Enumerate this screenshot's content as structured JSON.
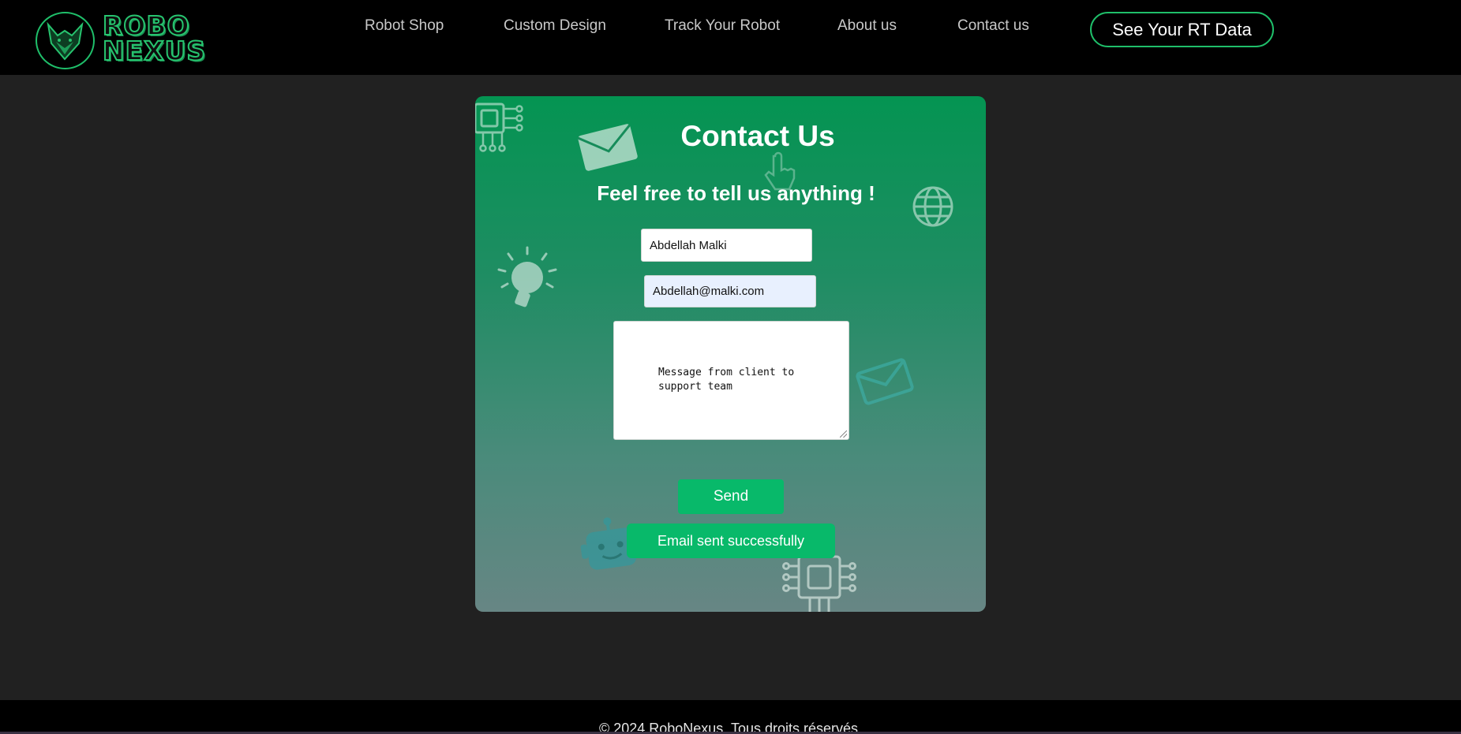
{
  "brand": {
    "line1": "ROBO",
    "line2": "NEXUS"
  },
  "nav": {
    "items": [
      {
        "label": "Robot Shop"
      },
      {
        "label": "Custom Design"
      },
      {
        "label": "Track Your Robot"
      },
      {
        "label": "About us"
      },
      {
        "label": "Contact us"
      }
    ],
    "cta_label": "See Your RT Data"
  },
  "contact": {
    "title": "Contact Us",
    "subtitle": "Feel free to tell us anything !",
    "name_value": "Abdellah Malki",
    "email_value": "Abdellah@malki.com",
    "message_value": "Message from client to support team",
    "send_label": "Send",
    "success_message": "Email sent successfully"
  },
  "footer": {
    "text": "© 2024 RoboNexus. Tous droits réservés."
  },
  "colors": {
    "accent": "#08b96a",
    "header_bg": "#000000",
    "page_bg": "#212121"
  }
}
